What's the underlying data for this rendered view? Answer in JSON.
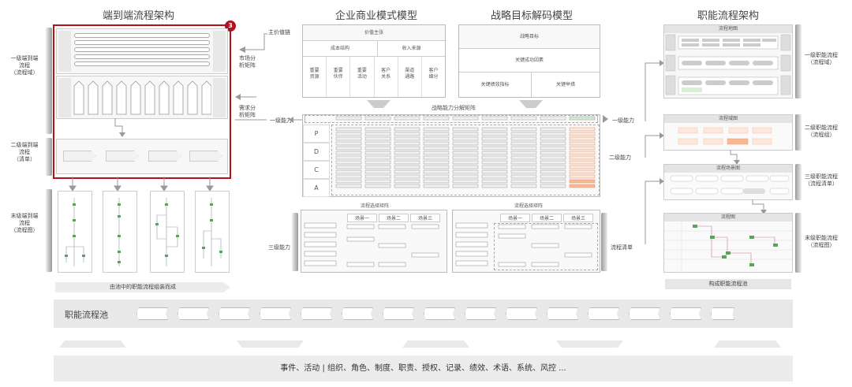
{
  "titles": {
    "e2e": "端到端流程架构",
    "business_model": "企业商业模式模型",
    "strategy_model": "战略目标解码模型",
    "functional": "职能流程架构"
  },
  "badge": "3",
  "left_labels": {
    "l1": [
      "一级端到端",
      "流程",
      "（流程域）"
    ],
    "l2": [
      "二级端到端",
      "流程",
      "（清单）"
    ],
    "l3": [
      "末级端到端",
      "流程",
      "（流程图）"
    ]
  },
  "left_footer": "由池中的职能流程组装而成",
  "mid_side_labels": {
    "main_value_chain": "主价值链",
    "market_matrix": [
      "市场分",
      "析矩阵"
    ],
    "demand_matrix": [
      "需求分",
      "析矩阵"
    ],
    "level1": "一级能力",
    "level2": "二级能力",
    "level3": "三级能力",
    "level1_right": "一级能力",
    "process_list": "流程清单"
  },
  "business_model": {
    "header": "价值主张",
    "sub_left": "成本结构",
    "sub_right": "收入来源",
    "cols": [
      [
        "重要",
        "资源"
      ],
      [
        "重要",
        "伙伴"
      ],
      [
        "重要",
        "活动"
      ],
      [
        "客户",
        "关系"
      ],
      [
        "渠道",
        "通路"
      ],
      [
        "客户",
        "细分"
      ]
    ]
  },
  "strategy_model": {
    "header": "战略目标",
    "mid": "关键成功因素",
    "left": "关键绩效指标",
    "right": "关键举措"
  },
  "matrix": {
    "title": "战略能力分解矩阵",
    "rows": [
      "P",
      "D",
      "C",
      "A"
    ]
  },
  "select_matrix": {
    "title": "流程选择矩阵",
    "scenes": [
      "场景一",
      "场景二",
      "场景三"
    ]
  },
  "right_labels": {
    "l1": [
      "一级职能流程",
      "（流程域）"
    ],
    "l2": [
      "二级职能流程",
      "（流程组）"
    ],
    "l3": [
      "三级职能流程",
      "（流程清单）"
    ],
    "l4": [
      "末级职能流程",
      "（流程图）"
    ]
  },
  "right_boxes": {
    "map": "流程地图",
    "group_map": "流程域图",
    "list_map": "流程场景图",
    "flow_map": "流程图"
  },
  "right_footer": "构成职能流程池",
  "pool_label": "职能流程池",
  "bottom_text": "事件、活动 | 组织、角色、制度、职责、授权、记录、绩效、术语、系统、风控 ..."
}
